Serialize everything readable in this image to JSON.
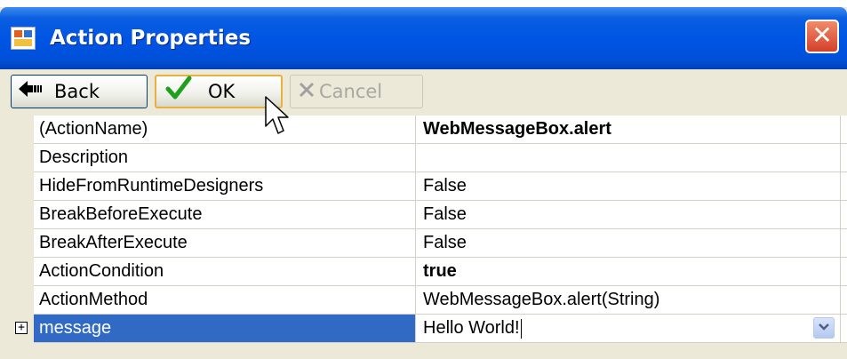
{
  "window": {
    "title": "Action Properties",
    "close_glyph": "✕"
  },
  "toolbar": {
    "back_label": "Back",
    "ok_label": "OK",
    "cancel_label": "Cancel",
    "back_icon": "back-arrow-icon",
    "ok_icon": "checkmark-icon",
    "cancel_icon": "x-icon"
  },
  "properties": [
    {
      "name": "(ActionName)",
      "value": "WebMessageBox.alert",
      "bold": true
    },
    {
      "name": "Description",
      "value": ""
    },
    {
      "name": "HideFromRuntimeDesigners",
      "value": "False"
    },
    {
      "name": "BreakBeforeExecute",
      "value": "False"
    },
    {
      "name": "BreakAfterExecute",
      "value": "False"
    },
    {
      "name": "ActionCondition",
      "value": "true",
      "bold": true
    },
    {
      "name": "ActionMethod",
      "value": "WebMessageBox.alert(String)"
    },
    {
      "name": "message",
      "value": "Hello World!",
      "selected": true
    }
  ],
  "colors": {
    "titlebar": "#0055e4",
    "selection": "#316ac5",
    "window_face": "#ece9d8"
  }
}
